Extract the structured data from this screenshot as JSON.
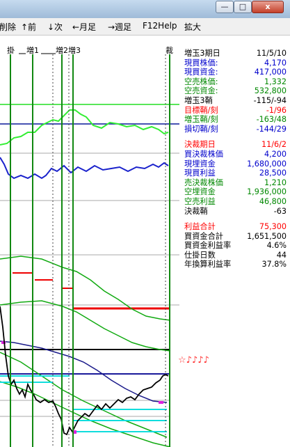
{
  "window": {
    "minimize_glyph": "—",
    "maximize_glyph": "□",
    "close_glyph": "x"
  },
  "menu": {
    "delete": "削除",
    "prev": "↑前",
    "next": "↓次",
    "prev_month": "←月足",
    "weekly": "→週足",
    "help": "F12Help",
    "zoom": "拡大"
  },
  "chart": {
    "markers": {
      "kake": "掛",
      "zou1": "増1",
      "zou2": "増2",
      "zou3": "増3",
      "sai": "裁"
    },
    "annotation": "☆♪♪♪♪"
  },
  "panel": {
    "g1": [
      {
        "label": "増玉3期日",
        "value": "11/5/10",
        "color": "#000000"
      },
      {
        "label": "現買株価:",
        "value": "4,170",
        "color": "#0000cc"
      },
      {
        "label": "現買資金:",
        "value": "417,000",
        "color": "#0000cc"
      },
      {
        "label": "空売株価:",
        "value": "1,332",
        "color": "#008800"
      },
      {
        "label": "空売資金:",
        "value": "532,800",
        "color": "#008800"
      },
      {
        "label": "増玉3鞘",
        "value": "-115/-94",
        "color": "#000000"
      },
      {
        "label": "目標鞘/刻",
        "value": "-1/96",
        "color": "#ff0000"
      },
      {
        "label": "増玉鞘/刻",
        "value": "-163/48",
        "color": "#008800"
      },
      {
        "label": "損切鞘/刻",
        "value": "-144/29",
        "color": "#0000cc"
      }
    ],
    "g2": [
      {
        "label": "決裁期日",
        "value": "11/6/2",
        "color": "#ff0000"
      },
      {
        "label": "買決裁株価",
        "value": "4,200",
        "color": "#0000cc"
      },
      {
        "label": "現埋資金",
        "value": "1,680,000",
        "color": "#0000cc"
      },
      {
        "label": "現買利益",
        "value": "28,500",
        "color": "#0000cc"
      },
      {
        "label": "売決裁株価",
        "value": "1,210",
        "color": "#008800"
      },
      {
        "label": "空埋資金",
        "value": "1,936,000",
        "color": "#008800"
      },
      {
        "label": "空売利益",
        "value": "46,800",
        "color": "#008800"
      },
      {
        "label": "決裁鞘",
        "value": "-63",
        "color": "#000000"
      }
    ],
    "g3": [
      {
        "label": "利益合計",
        "value": "75,300",
        "color": "#ff0000"
      },
      {
        "label": "買資金合計",
        "value": "1,651,500",
        "color": "#000000"
      },
      {
        "label": "買資金利益率",
        "value": "4.6%",
        "color": "#000000"
      },
      {
        "label": "仕掛日数",
        "value": "44",
        "color": "#000000"
      },
      {
        "label": "年換算利益率",
        "value": "37.8%",
        "color": "#000000"
      }
    ]
  }
}
